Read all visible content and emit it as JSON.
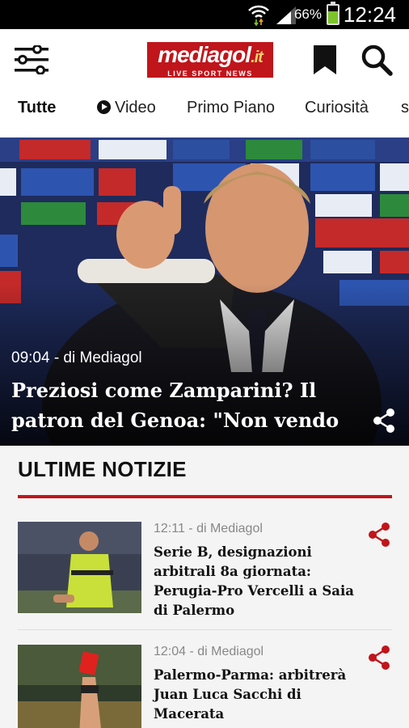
{
  "status_bar": {
    "battery": "66%",
    "battery_level": 0.66,
    "time": "12:24"
  },
  "app_bar": {
    "logo_brand": "mediagol",
    "logo_suffix": ".it",
    "logo_tagline": "LIVE SPORT NEWS",
    "icons": [
      "menu-icon",
      "bookmark-icon",
      "search-icon"
    ]
  },
  "tabs": [
    {
      "label": "Tutte",
      "active": true
    },
    {
      "label": "Video"
    },
    {
      "label": "Primo Piano"
    },
    {
      "label": "Curiosità"
    },
    {
      "label": "s"
    }
  ],
  "hero": {
    "meta": "09:04 - di Mediagol",
    "title": "Preziosi come Zamparini? Il patron del Genoa: \"Non vendo ..."
  },
  "section": {
    "title": "ULTIME NOTIZIE"
  },
  "news": [
    {
      "meta": "12:11 - di Mediagol",
      "title": "Serie B, designazioni arbitrali 8a giornata: Perugia-Pro Vercelli a Saia di Palermo"
    },
    {
      "meta": "12:04 - di Mediagol",
      "title": "Palermo-Parma: arbitrerà Juan Luca Sacchi di Macerata"
    }
  ],
  "colors": {
    "accent": "#c0151b",
    "status_bar": "#000000",
    "battery": "#7cc42a"
  }
}
